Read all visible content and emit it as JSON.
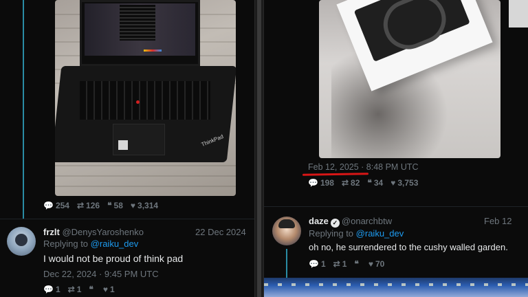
{
  "left_tweet": {
    "stats": {
      "replies": "254",
      "retweets": "126",
      "quotes": "58",
      "likes": "3,314"
    }
  },
  "frzlt_reply": {
    "display_name": "frzlt",
    "handle": "@DenysYaroshenko",
    "date": "22 Dec 2024",
    "replying_prefix": "Replying to",
    "replying_to": "@raiku_dev",
    "text": "I would not be proud of think pad",
    "timestamp": "Dec 22, 2024 · 9:45 PM UTC",
    "stats": {
      "replies": "1",
      "retweets": "1",
      "quotes": "",
      "likes": "1"
    }
  },
  "right_tweet": {
    "timestamp_date": "Feb 12, 2025",
    "timestamp_time": "· 8:48 PM UTC",
    "stats": {
      "replies": "198",
      "retweets": "82",
      "quotes": "34",
      "likes": "3,753"
    }
  },
  "daze_reply": {
    "display_name": "daze",
    "handle": "@onarchbtw",
    "date": "Feb 12",
    "replying_prefix": "Replying to",
    "replying_to": "@raiku_dev",
    "text": "oh no, he surrendered to the cushy walled garden.",
    "stats": {
      "replies": "1",
      "retweets": "1",
      "quotes": "",
      "likes": "70"
    }
  },
  "photo_text": {
    "laptop_brand": "ThinkPad"
  },
  "colors": {
    "link": "#1d9bf0",
    "muted": "#6e767d",
    "thread": "#2a8ca5",
    "highlight": "#d81616"
  },
  "icons": {
    "reply": "speech-bubble-icon",
    "retweet": "retweet-icon",
    "quote": "quote-icon",
    "like": "heart-icon",
    "verified": "verified-badge-icon"
  }
}
